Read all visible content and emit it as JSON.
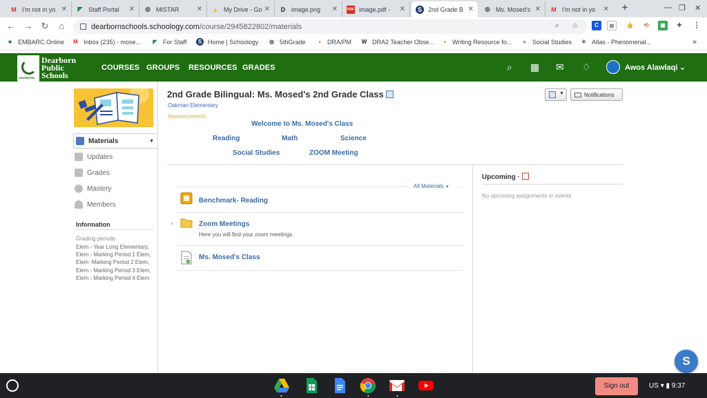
{
  "browser": {
    "tabs": [
      {
        "title": "I'm not in yo",
        "icon": "M",
        "icon_color": "#d93025",
        "active": false
      },
      {
        "title": "Staff Portal",
        "icon": "◤",
        "icon_color": "#1e8e3e",
        "active": false
      },
      {
        "title": "MISTAR",
        "icon": "◍",
        "icon_color": "#5f6368",
        "active": false
      },
      {
        "title": "My Drive - Go",
        "icon": "▲",
        "icon_color": "#fbbc04",
        "active": false
      },
      {
        "title": "image.png",
        "icon": "D",
        "icon_color": "#202124",
        "active": false
      },
      {
        "title": "image.pdf -",
        "icon": "PDF",
        "icon_color": "#d93025",
        "active": false
      },
      {
        "title": "2nd Grade B",
        "icon": "S",
        "icon_color": "#1f3b6e",
        "active": true
      },
      {
        "title": "Ms. Mosed's",
        "icon": "◍",
        "icon_color": "#5f6368",
        "active": false
      },
      {
        "title": "I'm not in yo",
        "icon": "M",
        "icon_color": "#d93025",
        "active": false
      }
    ],
    "url_host": "dearbornschools.schoology.com",
    "url_path": "/course/2945822802/materials",
    "bookmarks": [
      {
        "label": "EMBARC.Online",
        "icon": "■",
        "icon_color": "#2e7d32"
      },
      {
        "label": "Inbox (235) - mose...",
        "icon": "M",
        "icon_color": "#d93025"
      },
      {
        "label": "For Staff",
        "icon": "◤",
        "icon_color": "#1e8e3e"
      },
      {
        "label": "Home | Schoology",
        "icon": "S",
        "icon_color": "#1f3b6e"
      },
      {
        "label": "5thGrade",
        "icon": "◍",
        "icon_color": "#5f6368"
      },
      {
        "label": "DRA/PM",
        "icon": "◑",
        "icon_color": "#e37400"
      },
      {
        "label": "DRA2 Teacher Obse...",
        "icon": "W",
        "icon_color": "#202124"
      },
      {
        "label": "Writing Resource fo...",
        "icon": "◑",
        "icon_color": "#e37400"
      },
      {
        "label": "Social Studies",
        "icon": "●",
        "icon_color": "#a1887f"
      },
      {
        "label": "Atlas - Phenomenal...",
        "icon": "✳",
        "icon_color": "#5f6368"
      }
    ]
  },
  "header": {
    "logo_lines": [
      "Dearborn",
      "Public",
      "Schools"
    ],
    "nav": [
      "COURSES",
      "GROUPS",
      "RESOURCES",
      "GRADES"
    ],
    "user_name": "Awos Alawlaqi",
    "brand_color": "#1f6e12"
  },
  "sidebar": {
    "menu": [
      {
        "label": "Materials",
        "active": true
      },
      {
        "label": "Updates",
        "active": false
      },
      {
        "label": "Grades",
        "active": false
      },
      {
        "label": "Mastery",
        "active": false
      },
      {
        "label": "Members",
        "active": false
      }
    ],
    "info_title": "Information",
    "grading_label": "Grading periods",
    "grading_text": "Elem - Year Long Elementary, Elem - Marking Period 1 Elem, Elem -Marking Period 2 Elem, Elem - Marking Period 3 Elem, Elem - Marking Period 4 Elem"
  },
  "course": {
    "title": "2nd Grade Bilingual: Ms. Mosed's 2nd Grade Class",
    "school": "Oakman Elementary",
    "announcement_label": "Announcement:",
    "links": {
      "welcome": "Welcome to Ms. Mosed's Class",
      "reading": "Reading",
      "math": "Math",
      "science": "Science",
      "social": "Social Studies",
      "zoom": "ZOOM Meeting"
    },
    "notifications_label": "Notifications"
  },
  "materials": {
    "filter_label": "All Materials",
    "items": [
      {
        "title": "Benchmark- Reading",
        "desc": "",
        "type": "assessment"
      },
      {
        "title": "Zoom Meetings",
        "desc": "Here you will find your zoom meetings.",
        "type": "folder"
      },
      {
        "title": "Ms. Mosed's Class",
        "desc": "",
        "type": "page"
      }
    ]
  },
  "upcoming": {
    "title": "Upcoming ·",
    "empty": "No upcoming assignments or events"
  },
  "shelf": {
    "signout": "Sign out",
    "locale": "US",
    "time": "9:37"
  },
  "fab_letter": "S"
}
